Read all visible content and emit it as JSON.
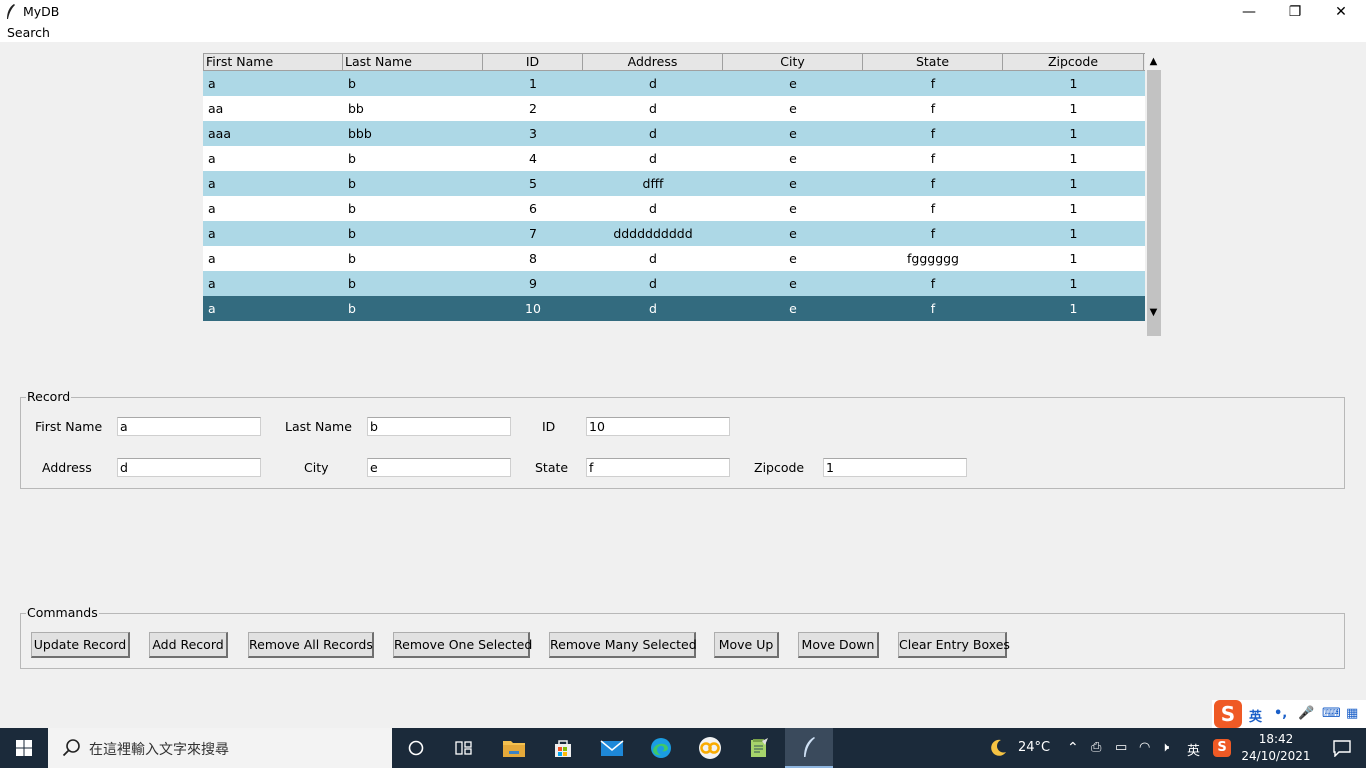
{
  "window": {
    "title": "MyDB",
    "minimize": "—",
    "maximize": "❐",
    "close": "✕"
  },
  "menu": {
    "search": "Search"
  },
  "table": {
    "columns": [
      "First Name",
      "Last Name",
      "ID",
      "Address",
      "City",
      "State",
      "Zipcode"
    ],
    "rows": [
      [
        "a",
        "b",
        "1",
        "d",
        "e",
        "f",
        "1"
      ],
      [
        "aa",
        "bb",
        "2",
        "d",
        "e",
        "f",
        "1"
      ],
      [
        "aaa",
        "bbb",
        "3",
        "d",
        "e",
        "f",
        "1"
      ],
      [
        "a",
        "b",
        "4",
        "d",
        "e",
        "f",
        "1"
      ],
      [
        "a",
        "b",
        "5",
        "dfff",
        "e",
        "f",
        "1"
      ],
      [
        "a",
        "b",
        "6",
        "d",
        "e",
        "f",
        "1"
      ],
      [
        "a",
        "b",
        "7",
        "dddddddddd",
        "e",
        "f",
        "1"
      ],
      [
        "a",
        "b",
        "8",
        "d",
        "e",
        "fgggggg",
        "1"
      ],
      [
        "a",
        "b",
        "9",
        "d",
        "e",
        "f",
        "1"
      ],
      [
        "a",
        "b",
        "10",
        "d",
        "e",
        "f",
        "1"
      ]
    ],
    "selected_row": 9,
    "scroll_up": "▲",
    "scroll_down": "▼"
  },
  "record": {
    "title": "Record",
    "first_name_label": "First Name",
    "first_name": "a",
    "last_name_label": "Last Name",
    "last_name": "b",
    "id_label": "ID",
    "id": "10",
    "address_label": "Address",
    "address": "d",
    "city_label": "City",
    "city": "e",
    "state_label": "State",
    "state": "f",
    "zipcode_label": "Zipcode",
    "zipcode": "1"
  },
  "commands": {
    "title": "Commands",
    "update": "Update Record",
    "add": "Add Record",
    "remove_all": "Remove All Records",
    "remove_one": "Remove One Selected",
    "remove_many": "Remove Many Selected",
    "move_up": "Move Up",
    "move_down": "Move Down",
    "clear": "Clear Entry Boxes"
  },
  "ime": {
    "logo": "S",
    "lang": "英",
    "punct": "•,",
    "mic": "🎤",
    "keyboard": "⌨",
    "grid": "▦"
  },
  "taskbar": {
    "search_placeholder": "在這裡輸入文字來搜尋",
    "weather": "24°C",
    "lang": "英",
    "time": "18:42",
    "date": "24/10/2021"
  },
  "colors": {
    "row_odd": "#add8e6",
    "row_even": "#ffffff",
    "row_selected": "#336b7f",
    "taskbar": "#1b2a3a"
  }
}
